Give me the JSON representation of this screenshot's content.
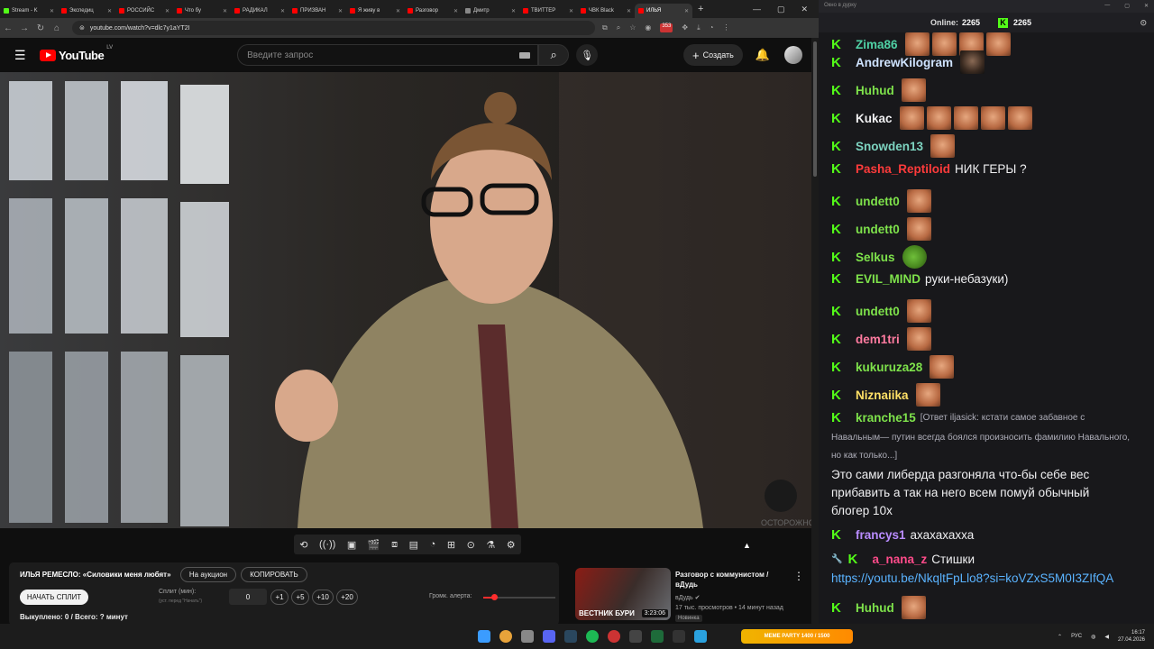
{
  "browser": {
    "tabs": [
      {
        "label": "Stream - K",
        "color": "#53fc18",
        "active": false
      },
      {
        "label": "Экспедиц",
        "color": "#ff0000",
        "active": false
      },
      {
        "label": "РОССИЙС",
        "color": "#ff0000",
        "active": false
      },
      {
        "label": "Что бу",
        "color": "#ff0000",
        "active": false
      },
      {
        "label": "РАДИКАЛ",
        "color": "#ff0000",
        "active": false
      },
      {
        "label": "ПРИЗВАН",
        "color": "#ff0000",
        "active": false
      },
      {
        "label": "Я живу в",
        "color": "#ff0000",
        "active": false
      },
      {
        "label": "Разговор",
        "color": "#ff0000",
        "active": false
      },
      {
        "label": "Дмитр",
        "color": "#888888",
        "active": false
      },
      {
        "label": "ТВИТТЕР",
        "color": "#ff0000",
        "active": false
      },
      {
        "label": "ЧВК Black",
        "color": "#ff0000",
        "active": false
      },
      {
        "label": "ИЛЬЯ",
        "color": "#ff0000",
        "active": true
      }
    ],
    "new_tab": "+",
    "url": "youtube.com/watch?v=dlc7y1aYT2I",
    "ext_badge": "353"
  },
  "youtube": {
    "logo": "YouTube",
    "region": "LV",
    "search_placeholder": "Введите запрос",
    "create_label": "Создать"
  },
  "video": {
    "watermark": "ОСТОРОЖНО"
  },
  "panel": {
    "title": "ИЛЬЯ РЕМЕСЛО: «Силовики меня любят»",
    "auction": "На аукцион",
    "copy": "КОПИРОВАТЬ",
    "start_split": "НАЧАТЬ СПЛИТ",
    "split_label": "Сплит (мин):",
    "split_hint": "(уст. перед \"Начать\")",
    "split_value": "0",
    "increments": [
      "+1",
      "+5",
      "+10",
      "+20"
    ],
    "alert_label": "Громк. алерта:",
    "alert_level": 0.15,
    "bought": "Выкуплено: 0 / Всего: ? минут"
  },
  "recommendation": {
    "title": "Разговор с коммунистом / вДудь",
    "channel": "вДудь",
    "stats": "17 тыс. просмотров • 14 минут назад",
    "badge": "Новинка",
    "thumb_text": "ВЕСТНИК БУРИ",
    "duration": "3:23:06"
  },
  "chat": {
    "window_title": "Окно в дурку",
    "online_label": "Online:",
    "online_count": "2265",
    "kick_count": "2265",
    "messages": [
      {
        "user": "Zima86",
        "color": "#4fd1a5",
        "text": "",
        "emotes": 4,
        "dark": false
      },
      {
        "user": "AndrewKilogram",
        "color": "#cfe3ff",
        "text": "",
        "emotes": 1,
        "dark": true
      },
      {
        "user": "Huhud",
        "color": "#7ee24b",
        "text": "",
        "emotes": 1,
        "dark": false
      },
      {
        "user": "Kukac",
        "color": "#efeff1",
        "text": "",
        "emotes": 5,
        "dark": false
      },
      {
        "user": "Snowden13",
        "color": "#7dd3c0",
        "text": "",
        "emotes": 1,
        "dark": false
      },
      {
        "user": "Pasha_Reptiloid",
        "color": "#ff3b3b",
        "text": "НИК ГЕРЫ ?",
        "emotes": 0,
        "dark": false
      },
      {
        "user": "undett0",
        "color": "#7ee24b",
        "text": "",
        "emotes": 1,
        "dark": false
      },
      {
        "user": "undett0",
        "color": "#7ee24b",
        "text": "",
        "emotes": 1,
        "dark": false
      },
      {
        "user": "Selkus",
        "color": "#7ee24b",
        "text": "",
        "emotes": 1,
        "dark": false,
        "frog": true
      },
      {
        "user": "EVIL_MIND",
        "color": "#7ee24b",
        "text": "руки-небазуки)",
        "emotes": 0,
        "dark": false
      },
      {
        "user": "undett0",
        "color": "#7ee24b",
        "text": "",
        "emotes": 1,
        "dark": false
      },
      {
        "user": "dem1tri",
        "color": "#ff7ba0",
        "text": "",
        "emotes": 1,
        "dark": false
      },
      {
        "user": "kukuruza28",
        "color": "#7ee24b",
        "text": "",
        "emotes": 1,
        "dark": false
      },
      {
        "user": "Niznaiika",
        "color": "#ffe066",
        "text": "",
        "emotes": 1,
        "dark": false
      }
    ],
    "reply_message": {
      "user": "kranche15",
      "color": "#7ee24b",
      "reply_prefix": "[Ответ iljasick: кстати самое забавное с",
      "reply_line2": "Навальным— путин всегда боялся произносить фамилию Навального,",
      "reply_line3": "но как только...]",
      "body_line1": "Это сами либерда разгоняла что-бы себе вес",
      "body_line2": "прибавить а так на него всем помуй обычный",
      "body_line3": "блогер 10х"
    },
    "after": [
      {
        "user": "francys1",
        "color": "#b98cff",
        "text": "ахахахахха"
      },
      {
        "user": "a_nana_z",
        "color": "#ff4b8a",
        "text": "Стишки",
        "link": "https://youtu.be/NkqltFpLlo8?si=koVZxS5M0I3ZIfQA"
      },
      {
        "user": "Huhud",
        "color": "#7ee24b",
        "text": ""
      }
    ]
  },
  "taskbar": {
    "meme_badge": "MEME PARTY 1400 / 1500",
    "lang": "РУС",
    "time": "16:17",
    "date": "27.04.2026"
  }
}
